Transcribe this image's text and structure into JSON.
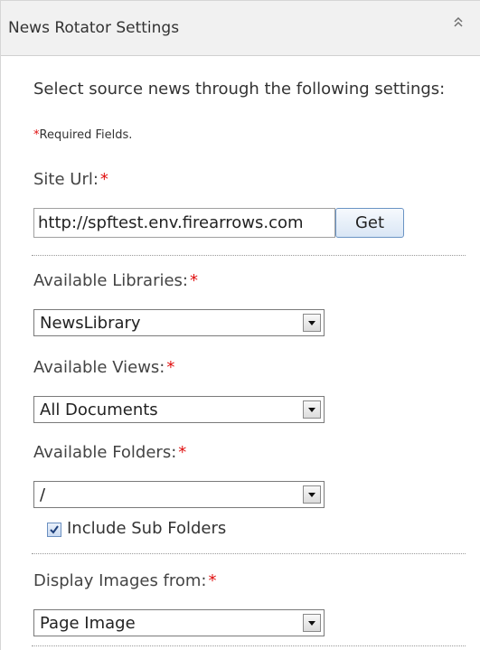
{
  "panel": {
    "title": "News Rotator Settings",
    "collapse_icon": "double-chevron-up-icon"
  },
  "intro": {
    "description": "Select source news through the following settings:",
    "required_star": "*",
    "required_note": "Required Fields."
  },
  "site_url": {
    "label": "Site Url:",
    "required_star": "*",
    "value": "http://spftest.env.firearrows.com",
    "button_label": "Get"
  },
  "libraries": {
    "label": "Available Libraries:",
    "required_star": "*",
    "selected": "NewsLibrary"
  },
  "views": {
    "label": "Available Views:",
    "required_star": "*",
    "selected": "All Documents"
  },
  "folders": {
    "label": "Available Folders:",
    "required_star": "*",
    "selected": "/",
    "include_subfolders_label": "Include Sub Folders",
    "include_subfolders_checked": true
  },
  "images": {
    "label": "Display Images from:",
    "required_star": "*",
    "selected": "Page Image"
  },
  "colors": {
    "required": "#e01010",
    "header_bg": "#f1f1f1",
    "button_border": "#6a94c4"
  }
}
